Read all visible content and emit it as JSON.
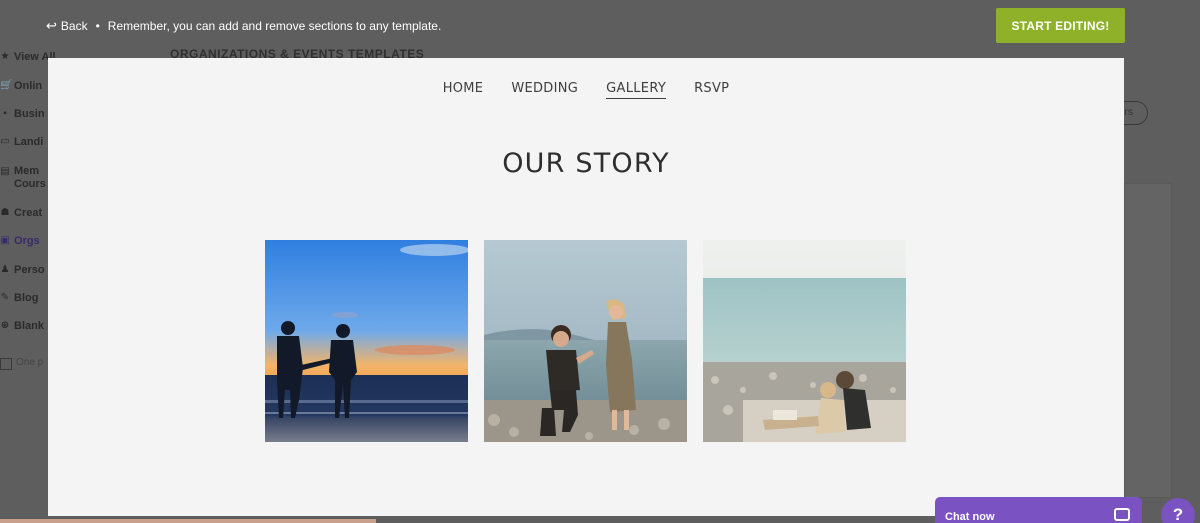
{
  "toolbar": {
    "back_label": "Back",
    "bullet": "•",
    "notice": "Remember, you can add and remove sections to any template.",
    "start_button": "START EDITING!"
  },
  "background": {
    "heading": "ORGANIZATIONS & EVENTS TEMPLATES",
    "sidebar": [
      {
        "icon": "★",
        "label": "View All"
      },
      {
        "icon": "🛒",
        "label": "Onlin"
      },
      {
        "icon": "▪",
        "label": "Busin"
      },
      {
        "icon": "▭",
        "label": "Landi"
      },
      {
        "icon": "▤",
        "label": "Mem\nCours"
      },
      {
        "icon": "☗",
        "label": "Creat"
      },
      {
        "icon": "▣",
        "label": "Orgs"
      },
      {
        "icon": "♟",
        "label": "Perso"
      },
      {
        "icon": "✎",
        "label": "Blog"
      },
      {
        "icon": "⊕",
        "label": "Blank"
      }
    ],
    "checkbox_label": "One p",
    "pill_label": "ers"
  },
  "preview": {
    "nav": [
      {
        "label": "HOME",
        "active": false
      },
      {
        "label": "WEDDING",
        "active": false
      },
      {
        "label": "GALLERY",
        "active": true
      },
      {
        "label": "RSVP",
        "active": false
      }
    ],
    "title": "OUR STORY",
    "photos": [
      {
        "name": "couple-sunset-beach-photo"
      },
      {
        "name": "proposal-on-beach-photo"
      },
      {
        "name": "couple-relaxing-shore-photo"
      }
    ]
  },
  "chat": {
    "label": "Chat now",
    "icon": "chat-bubble-icon"
  },
  "help": {
    "label": "?"
  }
}
